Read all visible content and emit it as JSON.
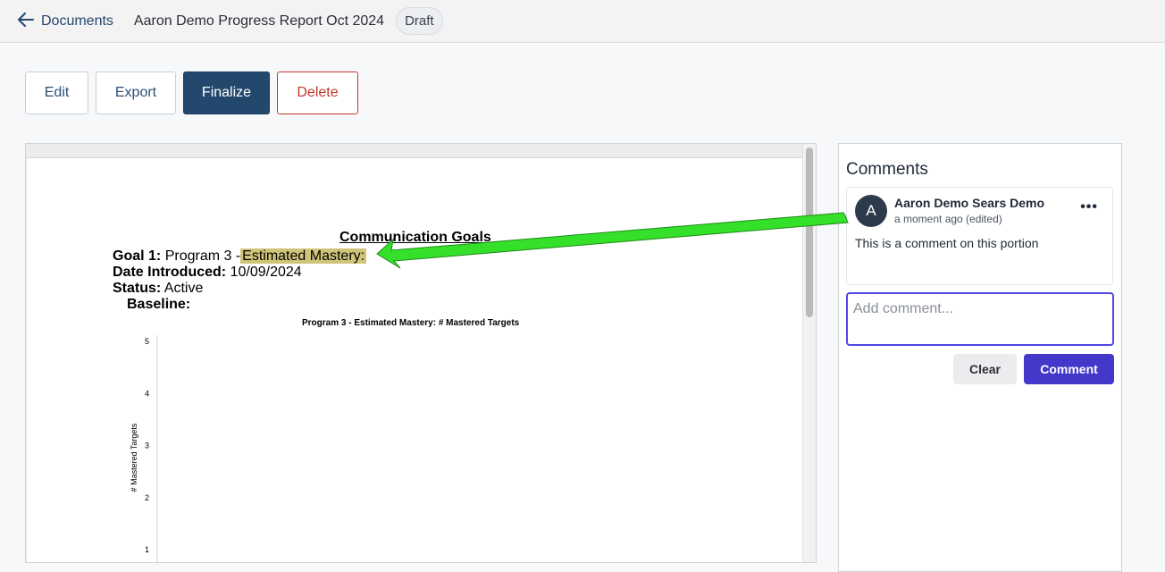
{
  "header": {
    "back_label": "Documents",
    "back_icon": "arrow-left-icon",
    "title": "Aaron Demo Progress Report Oct 2024",
    "status_badge": "Draft"
  },
  "actions": {
    "edit": "Edit",
    "export": "Export",
    "finalize": "Finalize",
    "delete": "Delete"
  },
  "document": {
    "section_title": "Communication Goals",
    "goal_label": "Goal 1:",
    "goal_program": "Program 3 -",
    "goal_highlight": "Estimated Mastery:",
    "date_label": "Date Introduced:",
    "date_value": "10/09/2024",
    "status_label": "Status:",
    "status_value": "Active",
    "baseline_label": "Baseline:"
  },
  "chart_data": {
    "type": "line",
    "title": "Program 3 - Estimated Mastery: # Mastered Targets",
    "ylabel": "# Mastered Targets",
    "xlabel": "",
    "ylim": [
      0,
      5
    ],
    "yticks": [
      1,
      2,
      3,
      4,
      5
    ],
    "series": []
  },
  "comments": {
    "title": "Comments",
    "items": [
      {
        "avatar_letter": "A",
        "author": "Aaron Demo Sears Demo",
        "meta": "a moment ago (edited)",
        "body": "This is a comment on this portion",
        "menu_icon": "more-horizontal-icon"
      }
    ],
    "input_placeholder": "Add comment...",
    "clear_label": "Clear",
    "submit_label": "Comment"
  },
  "colors": {
    "primary": "#23486e",
    "danger": "#c0392b",
    "accent": "#4338ca",
    "highlight": "#cfc57a",
    "annotation_arrow": "#35e02a"
  }
}
